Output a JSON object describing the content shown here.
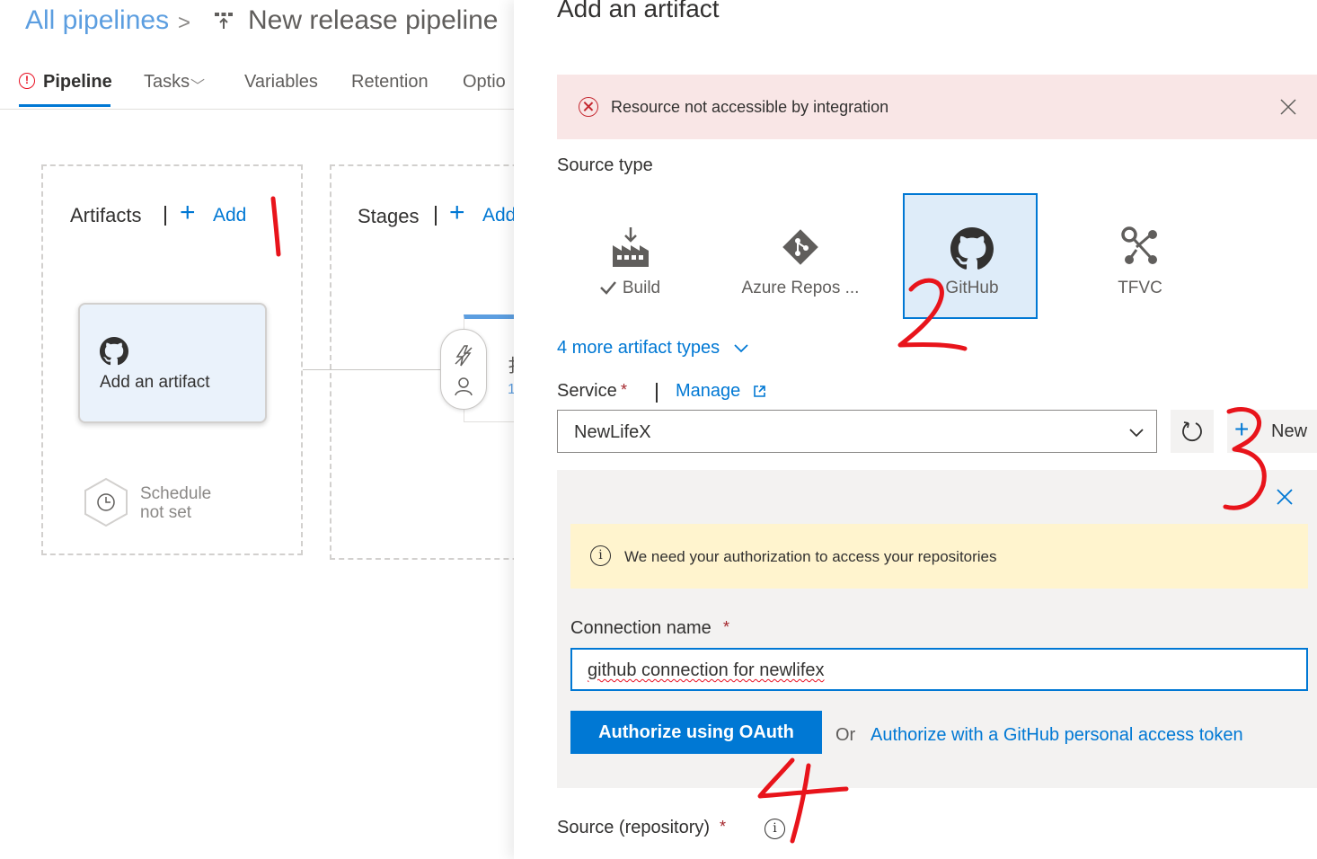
{
  "breadcrumb": {
    "all_pipelines": "All pipelines",
    "chevron": ">",
    "title": "New release pipeline"
  },
  "tabs": [
    {
      "label": "Pipeline",
      "active": true
    },
    {
      "label": "Tasks"
    },
    {
      "label": "Variables"
    },
    {
      "label": "Retention"
    },
    {
      "label": "Optio"
    }
  ],
  "canvas": {
    "artifacts_title": "Artifacts",
    "add_label": "Add",
    "stages_title": "Stages",
    "stages_add_label": "Add",
    "artifact_card_label": "Add an artifact",
    "schedule_text": "Schedule\nnot set",
    "stage_card_text": "扌",
    "stage_card_num": "1"
  },
  "panel": {
    "title": "Add an artifact",
    "error_message": "Resource not accessible by integration",
    "source_type_label": "Source type",
    "source_types": [
      {
        "label": "Build",
        "icon": "build-icon",
        "checked": true
      },
      {
        "label": "Azure Repos ...",
        "icon": "azure-repos-icon"
      },
      {
        "label": "GitHub",
        "icon": "github-icon",
        "selected": true
      },
      {
        "label": "TFVC",
        "icon": "tfvc-icon"
      }
    ],
    "more_types": "4 more artifact types",
    "service_label": "Service",
    "required_mark": "*",
    "manage_label": "Manage",
    "service_value": "NewLifeX",
    "new_label": "New",
    "auth_info": "We need your authorization to access your repositories",
    "connection_name_label": "Connection name",
    "connection_name_value": "github connection for newlifex",
    "oauth_button": "Authorize using OAuth",
    "or_text": "Or",
    "pat_link": "Authorize with a GitHub personal access token",
    "source_repo_label": "Source (repository)"
  },
  "colors": {
    "accent": "#0078d4",
    "error_bg": "#f9e6e6",
    "warning_bg": "#fff4ce",
    "annotation": "#e8141b"
  },
  "annotations": [
    "1",
    "2",
    "3",
    "4"
  ]
}
